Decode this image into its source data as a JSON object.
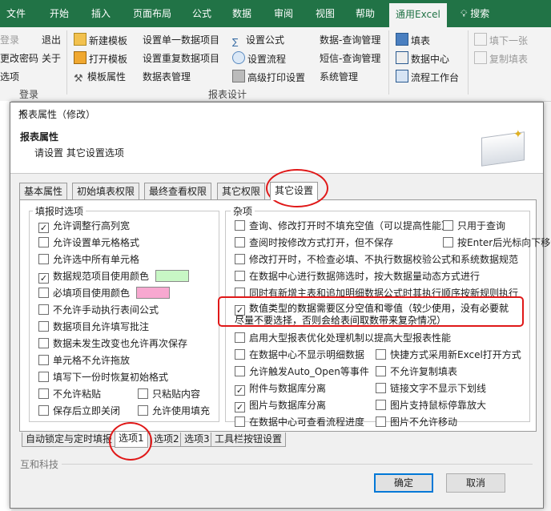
{
  "ribbon_tabs": [
    "文件",
    "开始",
    "插入",
    "页面布局",
    "公式",
    "数据",
    "审阅",
    "视图",
    "帮助",
    "通用Excel",
    "搜索"
  ],
  "ribbon": {
    "col1": [
      "登录",
      "更改密码",
      "选项"
    ],
    "col2": [
      "退出",
      "关于"
    ],
    "col3": [
      "新建模板",
      "打开模板",
      "模板属性"
    ],
    "col4": [
      "设置单一数据项目",
      "设置重复数据项目",
      "数据表管理"
    ],
    "col5": [
      "设置公式",
      "设置流程",
      "高级打印设置"
    ],
    "col6": [
      "数据-查询管理",
      "短信-查询管理",
      "系统管理"
    ],
    "col7": [
      "填表",
      "数据中心",
      "流程工作台"
    ],
    "col8": [
      "填下一张",
      "复制填表"
    ],
    "group_login": "登录",
    "group_design": "报表设计"
  },
  "dialog": {
    "title": "报表属性（修改）",
    "header_title": "报表属性",
    "header_subtitle": "请设置 其它设置选项",
    "tabs": [
      "基本属性",
      "初始填表权限",
      "最终查看权限",
      "其它权限",
      "其它设置"
    ],
    "group_fill": "填报时选项",
    "group_misc": "杂项",
    "fill_options": [
      {
        "label": "允许调整行高列宽",
        "checked": true
      },
      {
        "label": "允许设置单元格格式",
        "checked": false
      },
      {
        "label": "允许选中所有单元格",
        "checked": false
      },
      {
        "label": "数据规范项目使用颜色",
        "checked": true
      },
      {
        "label": "必填项目使用颜色",
        "checked": false
      },
      {
        "label": "不允许手动执行表间公式",
        "checked": false
      },
      {
        "label": "数据项目允许填写批注",
        "checked": false
      },
      {
        "label": "数据未发生改变也允许再次保存",
        "checked": false
      },
      {
        "label": "单元格不允许拖放",
        "checked": false
      },
      {
        "label": "填写下一份时恢复初始格式",
        "checked": false
      }
    ],
    "fill_pairs": [
      {
        "left": {
          "label": "不允许粘贴",
          "checked": false
        },
        "right": {
          "label": "只粘贴内容",
          "checked": false
        }
      },
      {
        "left": {
          "label": "保存后立即关闭",
          "checked": false
        },
        "right": {
          "label": "允许使用填充",
          "checked": false
        }
      }
    ],
    "color_swatches": {
      "normative": "#c8f7c5",
      "required": "#f7a8d0"
    },
    "misc_full": [
      {
        "label": "查询、修改打开时不填充空值（可以提高性能）",
        "checked": false,
        "side": {
          "label": "只用于查询",
          "checked": false
        }
      },
      {
        "label": "查阅时按修改方式打开，但不保存",
        "checked": false,
        "side": {
          "label": "按Enter后光标向下移动",
          "checked": false
        }
      },
      {
        "label": "修改打开时，不检查必填、不执行数据校验公式和系统数据规范",
        "checked": false
      },
      {
        "label": "在数据中心进行数据筛选时，按大数据量动态方式进行",
        "checked": false
      },
      {
        "label": "同时有新增主表和追加明细数据公式时其执行顺序按新规则执行",
        "checked": false
      },
      {
        "label": "数值类型的数据需要区分空值和零值（较少使用，没有必要就尽量不要选择，否则会给表间取数带来复杂情况）",
        "checked": true
      },
      {
        "label": "启用大型报表优化处理机制以提高大型报表性能",
        "checked": false
      }
    ],
    "misc_pairs": [
      {
        "left": {
          "label": "在数据中心不显示明细数据",
          "checked": false
        },
        "right": {
          "label": "快捷方式采用新Excel打开方式",
          "checked": false
        }
      },
      {
        "left": {
          "label": "允许触发Auto_Open等事件",
          "checked": false
        },
        "right": {
          "label": "不允许复制填表",
          "checked": false
        }
      },
      {
        "left": {
          "label": "附件与数据库分离",
          "checked": true
        },
        "right": {
          "label": "链接文字不显示下划线",
          "checked": false
        }
      },
      {
        "left": {
          "label": "图片与数据库分离",
          "checked": true
        },
        "right": {
          "label": "图片支持鼠标停靠放大",
          "checked": false
        }
      },
      {
        "left": {
          "label": "在数据中心可查看流程进度",
          "checked": false
        },
        "right": {
          "label": "图片不允许移动",
          "checked": false
        }
      }
    ],
    "bottom_tabs": [
      "自动锁定与定时填报",
      "选项1",
      "选项2",
      "选项3",
      "工具栏按钮设置"
    ],
    "footer_brand": "互和科技",
    "ok": "确定",
    "cancel": "取消",
    "check_mark": "✓"
  }
}
